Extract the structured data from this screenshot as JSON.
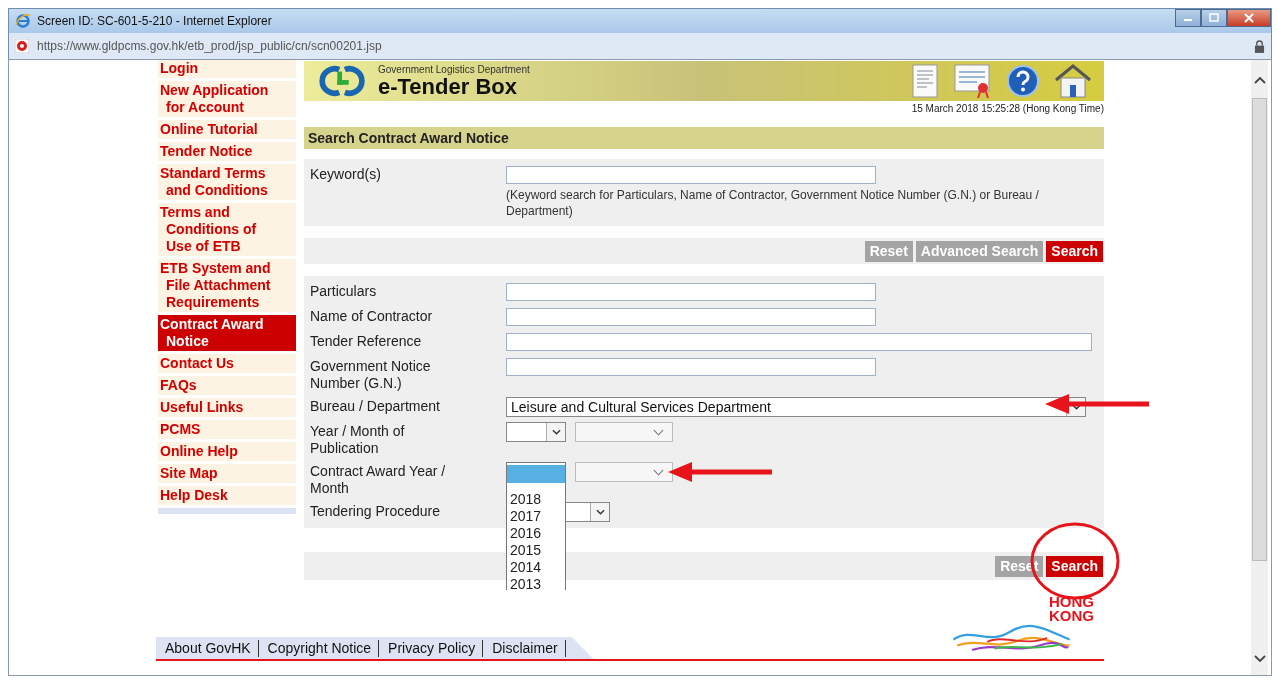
{
  "window": {
    "title": "Screen ID: SC-601-5-210 - Internet Explorer"
  },
  "address_bar": {
    "url": "https://www.gldpcms.gov.hk/etb_prod/jsp_public/cn/scn00201.jsp"
  },
  "sidebar": {
    "items": [
      {
        "label": "Login",
        "selected": false
      },
      {
        "label": "New Application for Account",
        "selected": false
      },
      {
        "label": "Online Tutorial",
        "selected": false
      },
      {
        "label": "Tender Notice",
        "selected": false
      },
      {
        "label": "Standard Terms and Conditions",
        "selected": false
      },
      {
        "label": "Terms and Conditions of Use of ETB",
        "selected": false
      },
      {
        "label": "ETB System and File Attachment Requirements",
        "selected": false
      },
      {
        "label": "Contract Award Notice",
        "selected": true
      },
      {
        "label": "Contact Us",
        "selected": false
      },
      {
        "label": "FAQs",
        "selected": false
      },
      {
        "label": "Useful Links",
        "selected": false
      },
      {
        "label": "PCMS",
        "selected": false
      },
      {
        "label": "Online Help",
        "selected": false
      },
      {
        "label": "Site Map",
        "selected": false
      },
      {
        "label": "Help Desk",
        "selected": false
      }
    ]
  },
  "header": {
    "department": "Government Logistics Department",
    "title": "e-Tender Box",
    "datetime": "15 March 2018 15:25:28 (Hong Kong Time)"
  },
  "panel_title": "Search Contract Award Notice",
  "keyword": {
    "label": "Keyword(s)",
    "hint": "(Keyword search for Particulars, Name of Contractor, Government Notice Number (G.N.) or Bureau / Department)"
  },
  "top_buttons": [
    {
      "label": "Reset",
      "kind": "grey"
    },
    {
      "label": "Advanced Search",
      "kind": "grey"
    },
    {
      "label": "Search",
      "kind": "red"
    }
  ],
  "fields": [
    {
      "label": "Particulars",
      "kind": "text"
    },
    {
      "label": "Name of Contractor",
      "kind": "text"
    },
    {
      "label": "Tender Reference",
      "kind": "text-wide"
    },
    {
      "label": "Government Notice Number (G.N.)",
      "kind": "text"
    },
    {
      "label": "Bureau / Department",
      "kind": "select-wide",
      "value": "Leisure and Cultural Services Department"
    },
    {
      "label": "Year / Month of Publication",
      "kind": "select-pair"
    },
    {
      "label": "Contract Award Year / Month",
      "kind": "select-pair-open",
      "options": [
        "2018",
        "2017",
        "2016",
        "2015",
        "2014",
        "2013"
      ]
    },
    {
      "label": "Tendering Procedure",
      "kind": "select"
    }
  ],
  "bottom_buttons": [
    {
      "label": "Reset",
      "kind": "grey"
    },
    {
      "label": "Search",
      "kind": "red"
    }
  ],
  "footer": {
    "links": [
      "About GovHK",
      "Copyright Notice",
      "Privacy Policy",
      "Disclaimer"
    ],
    "logo_text": [
      "HONG",
      "KONG"
    ]
  }
}
